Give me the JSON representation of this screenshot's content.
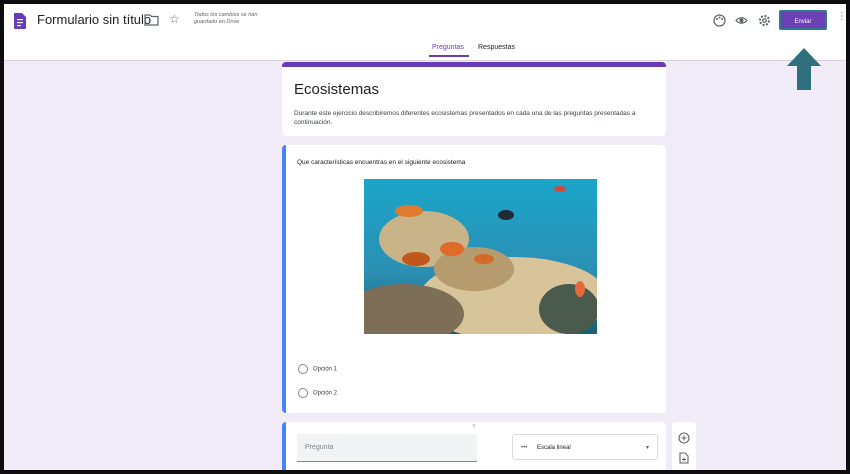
{
  "header": {
    "title": "Formulario sin título",
    "save_status": "Todos los cambios se han guardado en Drive",
    "send_label": "Enviar",
    "icons": [
      "document-icon",
      "folder-icon",
      "star-icon",
      "palette-icon",
      "preview-eye-icon",
      "settings-icon",
      "more-vert-icon"
    ]
  },
  "tabs": [
    {
      "label": "Preguntas",
      "active": true
    },
    {
      "label": "Respuestas",
      "active": false
    }
  ],
  "form": {
    "title": "Ecosistemas",
    "description": "Durante este ejercicio describiremos diferentes ecosistemas presentados en cada una de las preguntas presentadas a continuación."
  },
  "question1": {
    "text": "Que características encuentras en el siguiente ecosistema",
    "options": [
      "Opción 1",
      "Opción 2"
    ]
  },
  "question2": {
    "placeholder": "Pregunta",
    "type_label": "Escala lineal",
    "drag_handle": "⠿"
  },
  "colors": {
    "accent": "#673ab7",
    "question_border": "#4285f4",
    "background": "#f1eaf7",
    "arrow": "#2f6f7e"
  }
}
